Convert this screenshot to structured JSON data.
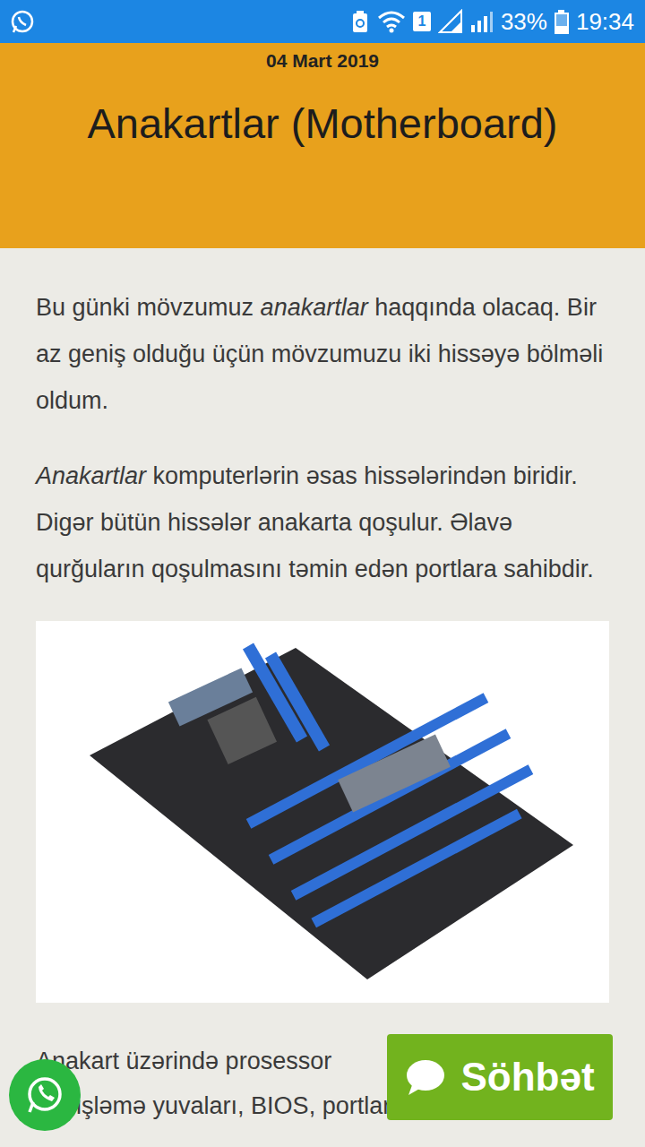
{
  "status_bar": {
    "sim": "1",
    "battery": "33%",
    "battery_level": 0.33,
    "time": "19:34"
  },
  "post": {
    "date": "04 Mart 2019",
    "title": "Anakartlar (Motherboard)",
    "paragraphs": [
      [
        {
          "text": "Bu günki mövzumuz ",
          "emphasis": false
        },
        {
          "text": "anakartlar",
          "emphasis": true
        },
        {
          "text": " haqqında olacaq. Bir az geniş olduğu üçün mövzumuzu iki hissəyə bölməli oldum.",
          "emphasis": false
        }
      ],
      [
        {
          "text": "Anakartlar",
          "emphasis": true
        },
        {
          "text": " komputerlərin əsas hissələrindən biridir. Digər bütün hissələr anakarta qoşulur. Əlavə qurğuların qoşulmasını təmin edən portlara sahibdir.",
          "emphasis": false
        }
      ]
    ],
    "partial_lines": [
      "Anakart üzərində prosessor",
      "genişləmə yuvaları, BIOS, portlar və köməkçi"
    ]
  },
  "chat_button": {
    "label": "Söhbət"
  }
}
